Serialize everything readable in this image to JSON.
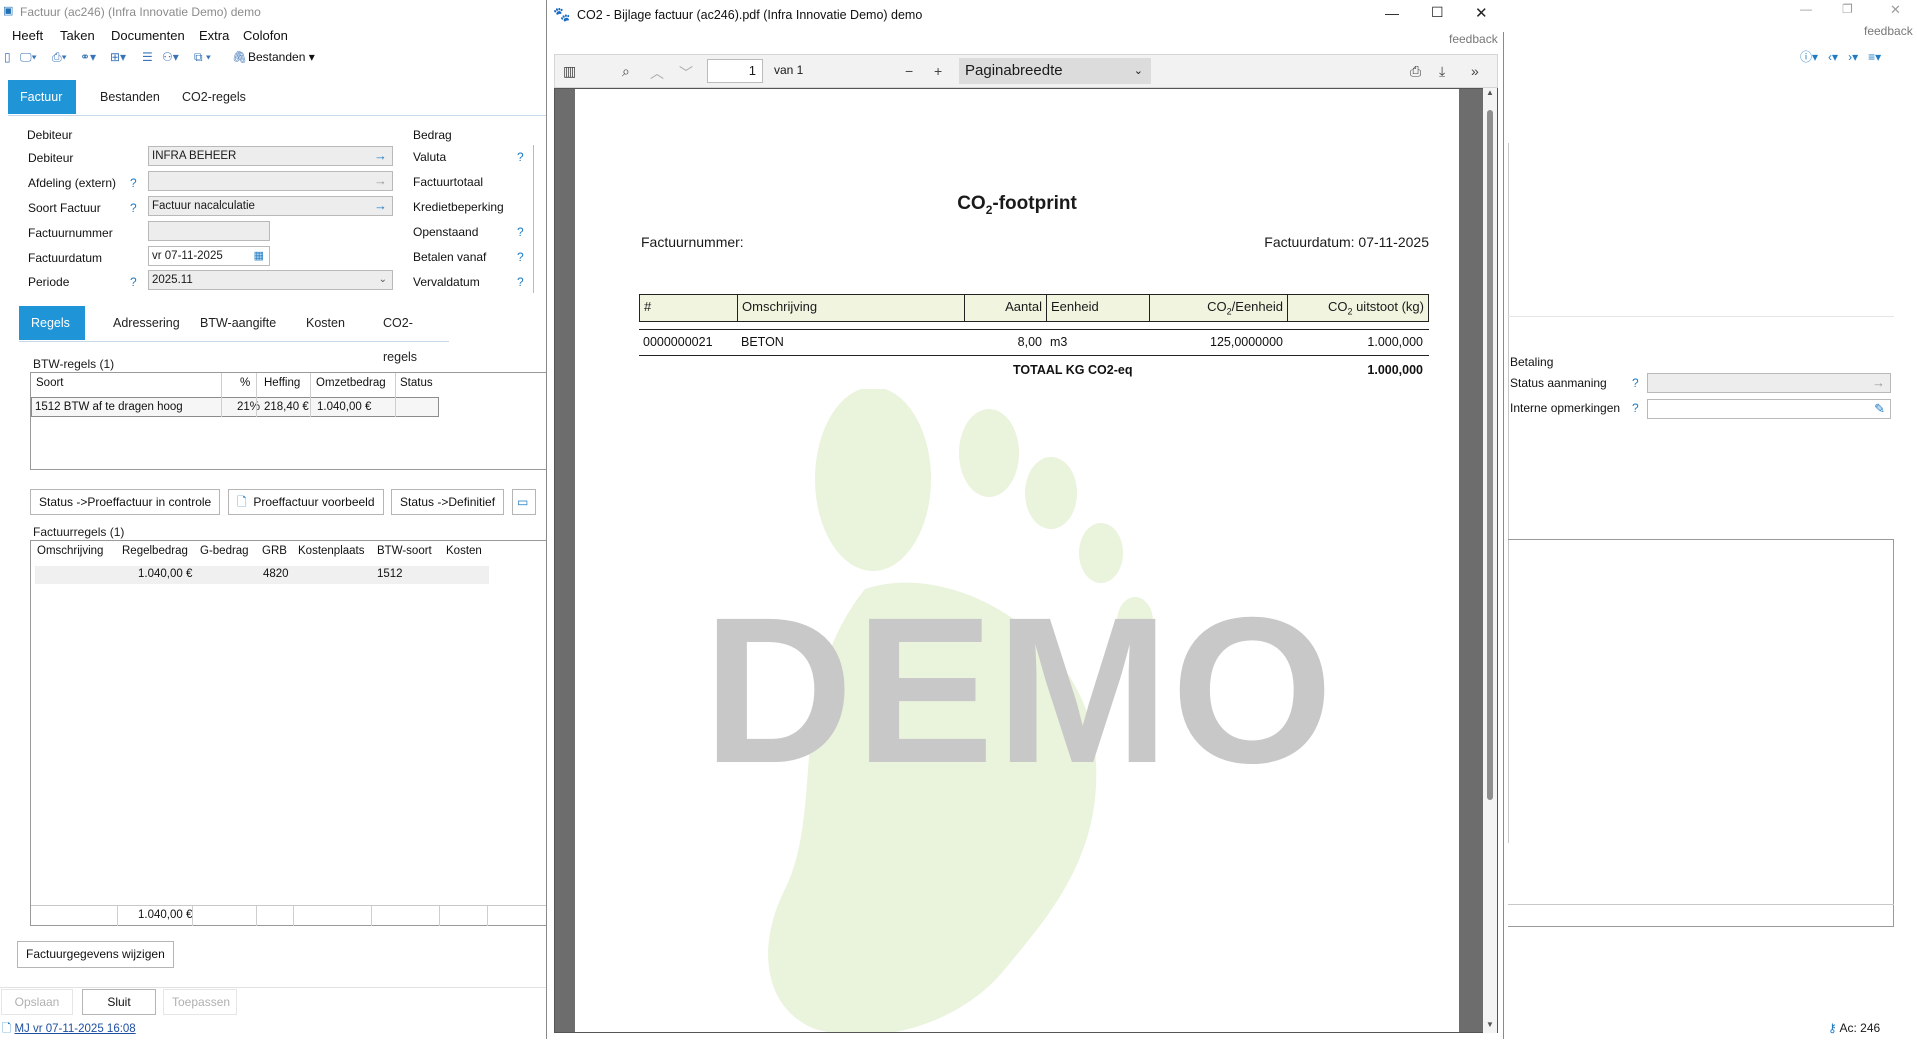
{
  "main_window": {
    "title": "Factuur (ac246) (Infra Innovatie Demo) demo",
    "feedback": "feedback",
    "menu": [
      "Heeft",
      "Taken",
      "Documenten",
      "Extra",
      "Colofon"
    ],
    "toolbar_bestanden": "Bestanden",
    "top_tabs": [
      "Factuur",
      "Bestanden",
      "CO2-regels"
    ],
    "debiteur_group": {
      "title": "Debiteur",
      "fields": [
        {
          "label": "Debiteur",
          "value": ""
        },
        {
          "label": "Afdeling (extern)",
          "value": ""
        },
        {
          "label": "Soort Factuur",
          "value": ""
        },
        {
          "label": "Factuurnummer",
          "value": ""
        },
        {
          "label": "Factuurdatum",
          "value": ""
        },
        {
          "label": "Periode",
          "value": ""
        }
      ],
      "debiteur_value": "INFRA BEHEER",
      "soort_value": "Factuur nacalculatie",
      "factuurdatum_value": "vr 07-11-2025",
      "periode_value": "2025.11"
    },
    "bedrag_group": {
      "title": "Bedrag",
      "labels": [
        "Valuta",
        "Factuurtotaal",
        "Kredietbeperking",
        "Openstaand",
        "Betalen vanaf",
        "Vervaldatum"
      ]
    },
    "sub_tabs": [
      "Regels",
      "Adressering",
      "BTW-aangifte",
      "Kosten",
      "CO2-regels"
    ],
    "btw_regels": {
      "title": "BTW-regels (1)",
      "headers": [
        "Soort",
        "%",
        "Heffing",
        "Omzetbedrag",
        "Status"
      ],
      "rows": [
        [
          "1512 BTW af te dragen hoog",
          "21%",
          "218,40 €",
          "1.040,00 €",
          ""
        ]
      ]
    },
    "action_buttons": [
      "Status ->Proeffactuur in controle",
      "Proeffactuur voorbeeld",
      "Status ->Definitief"
    ],
    "factuurregels": {
      "title": "Factuurregels (1)",
      "headers": [
        "Omschrijving",
        "Regelbedrag",
        "G-bedrag",
        "GRB",
        "Kostenplaats",
        "BTW-soort",
        "Kosten"
      ],
      "rows": [
        [
          "",
          "1.040,00 €",
          "",
          "4820",
          "",
          "1512",
          ""
        ]
      ],
      "footer_total": "1.040,00 €"
    },
    "betaling": {
      "title": "Betaling",
      "labels": [
        "Status aanmaning",
        "Interne opmerkingen"
      ]
    },
    "wijzigen_button": "Factuurgegevens wijzigen",
    "bottom_buttons": [
      "Opslaan",
      "Sluit",
      "Toepassen"
    ],
    "status_left": "MJ vr 07-11-2025 16:08",
    "status_right": "Ac: 246"
  },
  "pdf_window": {
    "title": "CO2 - Bijlage factuur (ac246).pdf  (Infra Innovatie Demo) demo",
    "feedback": "feedback",
    "page_input": "1",
    "page_of": "van 1",
    "zoom": "Paginabreedte",
    "doc": {
      "heading_pre": "CO",
      "heading_sub": "2",
      "heading_post": "-footprint",
      "factuurnummer_label": "Factuurnummer:",
      "factuurdatum_label": "Factuurdatum: 07-11-2025",
      "table_headers": {
        "nr": "#",
        "omschrijving": "Omschrijving",
        "aantal": "Aantal",
        "eenheid": "Eenheid",
        "co2_eenheid_pre": "CO",
        "co2_eenheid_post": "/Eenheid",
        "co2_uitstoot_pre": "CO",
        "co2_uitstoot_post": " uitstoot (kg)",
        "sub": "2"
      },
      "rows": [
        {
          "nr": "0000000021",
          "omschrijving": "BETON",
          "aantal": "8,00",
          "eenheid": "m3",
          "co2_eenheid": "125,0000000",
          "co2_uitstoot": "1.000,000"
        }
      ],
      "totaal_label": "TOTAAL KG CO2-eq",
      "totaal_value": "1.000,000",
      "watermark": "DEMO"
    }
  },
  "colors": {
    "accent": "#1f94d6",
    "footprint": "#eaf3dc",
    "table_header": "#f1f5e0",
    "watermark": "#c8c8c8"
  }
}
